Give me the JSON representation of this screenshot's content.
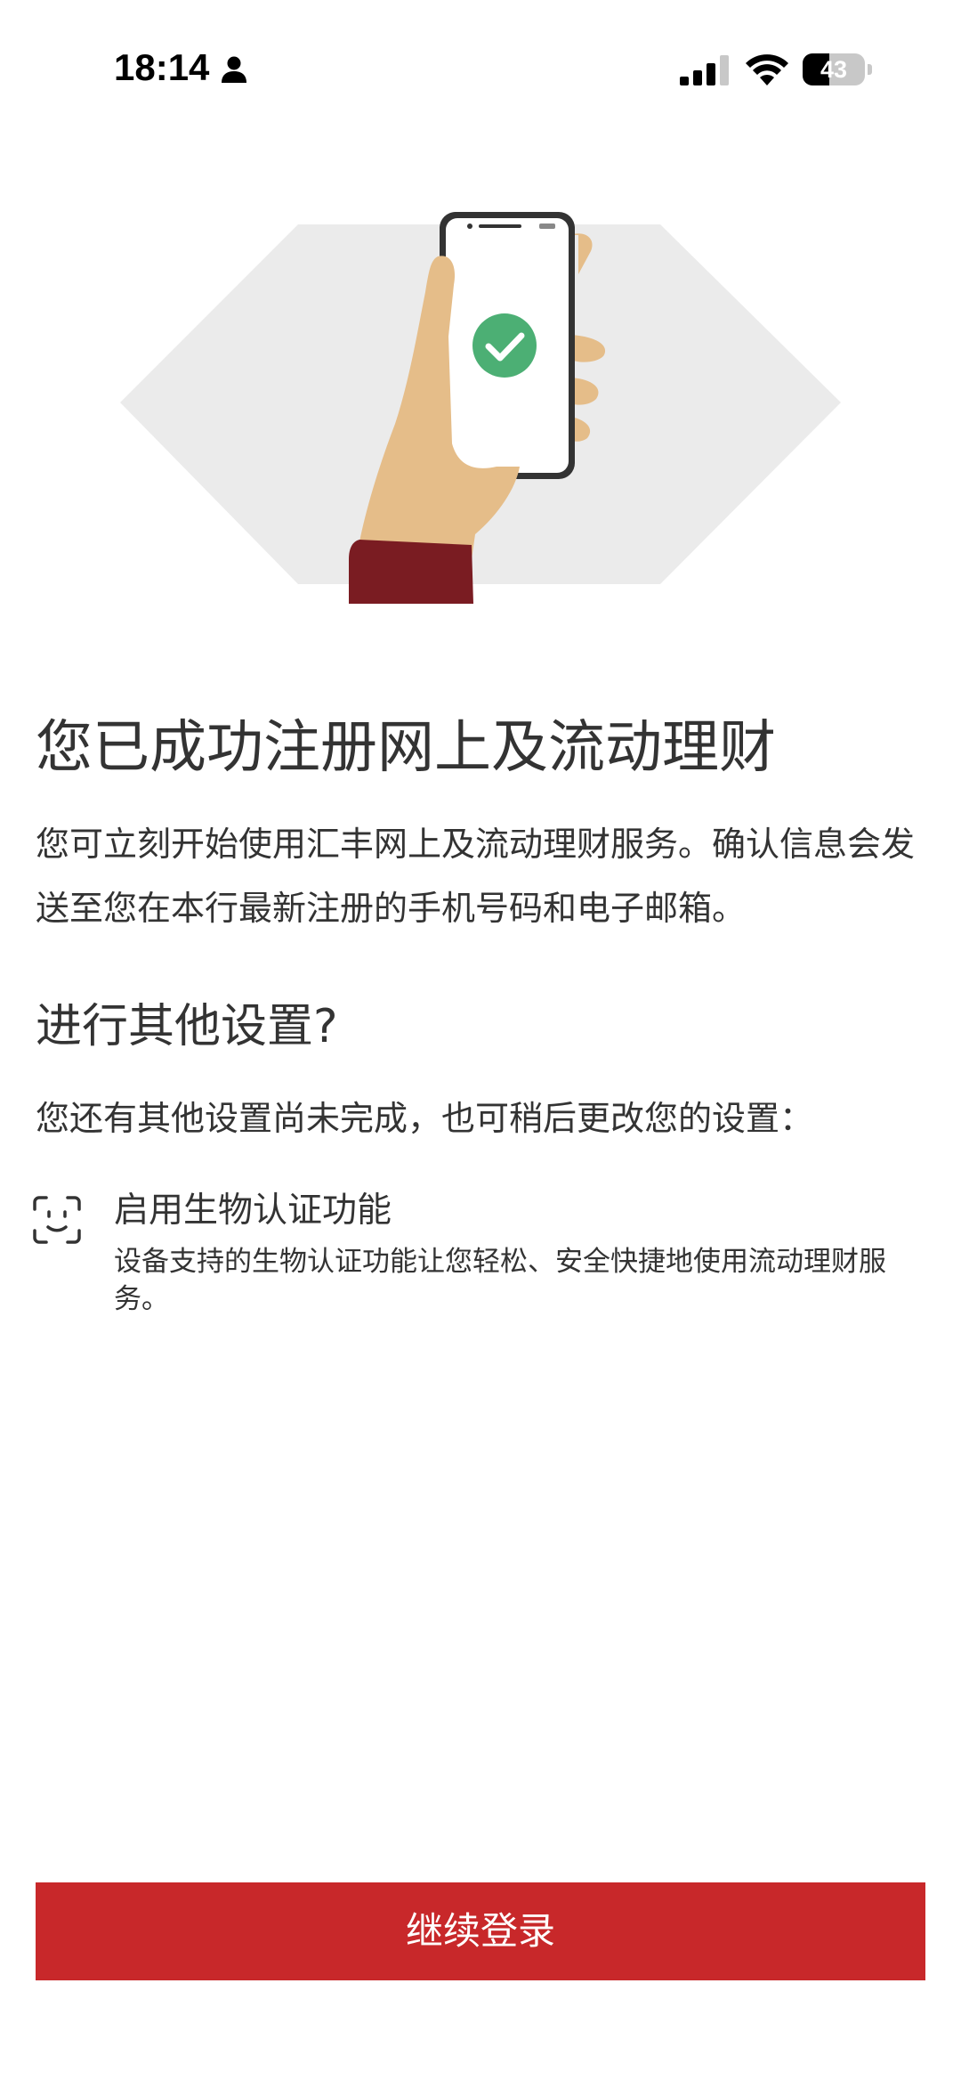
{
  "status_bar": {
    "time": "18:14",
    "battery_level": "43",
    "battery_fraction": 0.43,
    "icons": [
      "person-icon",
      "signal-icon",
      "wifi-icon",
      "battery-icon"
    ]
  },
  "illustration": {
    "description_icon": "phone-with-checkmark-illustration",
    "check_color": "#4caf74",
    "sleeve_color": "#7a1c22",
    "hand_color": "#e5bd89",
    "hexagon_color": "#ebebeb"
  },
  "main": {
    "title": "您已成功注册网上及流动理财",
    "description": "您可立刻开始使用汇丰网上及流动理财服务。确认信息会发送至您在本行最新注册的手机号码和电子邮箱。",
    "section_title": "进行其他设置?",
    "section_description": "您还有其他设置尚未完成，也可稍后更改您的设置：",
    "biometric": {
      "icon": "face-id-icon",
      "title": "启用生物认证功能",
      "description": "设备支持的生物认证功能让您轻松、安全快捷地使用流动理财服务。"
    }
  },
  "footer": {
    "continue_label": "继续登录",
    "button_color": "#c8282a"
  }
}
